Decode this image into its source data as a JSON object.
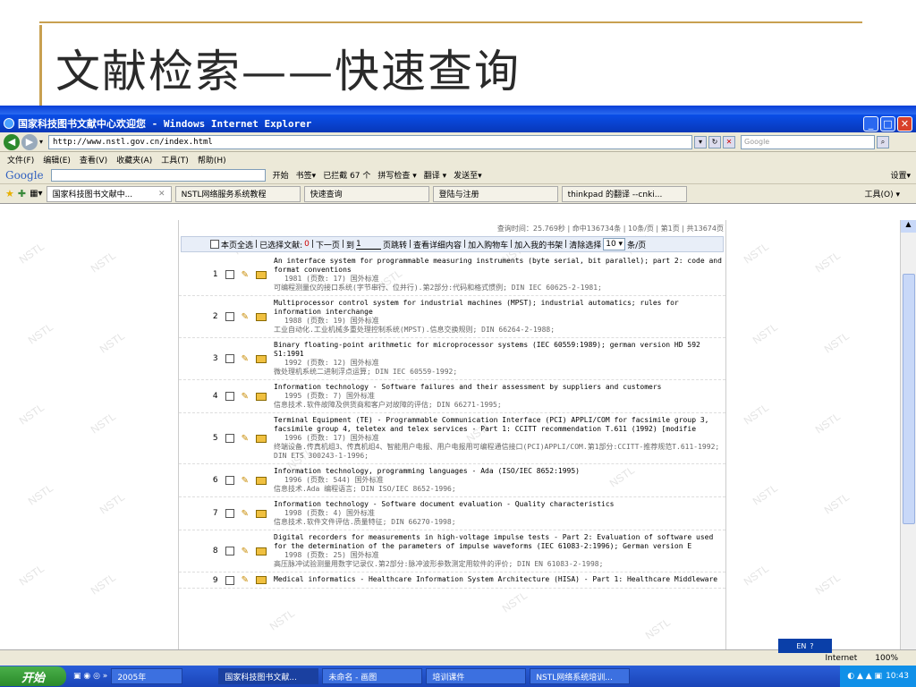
{
  "slide": {
    "title": "文献检索——快速查询"
  },
  "browser": {
    "title": "国家科技图书文献中心欢迎您 - Windows Internet Explorer",
    "url": "http://www.nstl.gov.cn/index.html",
    "search_placeholder": "Google",
    "menu": [
      "文件(F)",
      "编辑(E)",
      "查看(V)",
      "收藏夹(A)",
      "工具(T)",
      "帮助(H)"
    ],
    "google_toolbar": {
      "logo": "Google",
      "items": [
        "开始",
        "书签▾",
        "已拦截 67 个",
        "拼写检查 ▾",
        "翻译 ▾",
        "发送至▾"
      ],
      "settings": "设置▾"
    },
    "tabs": [
      "国家科技图书文献中...",
      "NSTL网络服务系统教程",
      "快速查询",
      "登陆与注册",
      "thinkpad 的翻译 --cnki..."
    ],
    "tools_label": "工具(O) ▾",
    "status": {
      "zone": "Internet",
      "zoom": "100%"
    }
  },
  "results": {
    "stats": "查询时间：25.769秒 | 命中136734条 | 10条/页 | 第1页 | 共13674页",
    "toolbar": {
      "select_all": "本页全选",
      "selected": "已选择文献:",
      "selected_count": "0",
      "next_page": "下一页",
      "goto_label": "到",
      "goto_value": "1",
      "goto_suffix": "页跳转",
      "view_detail": "查看详细内容",
      "add_cart": "加入购物车",
      "add_shelf": "加入我的书架",
      "clear": "清除选择",
      "per_page": "10",
      "per_page_suffix": "条/页"
    },
    "items": [
      {
        "num": "1",
        "title": "An interface system for programmable measuring instruments (byte serial, bit parallel); part 2: code and format conventions",
        "meta": "1981  (页数: 17)  国外标准",
        "cn": "可编程测量仪的接口系统(字节串行、位并行).第2部分:代码和格式惯例; DIN IEC 60625-2-1981;"
      },
      {
        "num": "2",
        "title": "Multiprocessor control system for industrial machines (MPST); industrial automatics; rules for information interchange",
        "meta": "1988  (页数: 19)  国外标准",
        "cn": "工业自动化.工业机械多重处理控制系统(MPST).信息交换规则; DIN 66264-2-1988;"
      },
      {
        "num": "3",
        "title": "Binary floating-point arithmetic for microprocessor systems (IEC 60559:1989); german version HD 592 S1:1991",
        "meta": "1992  (页数: 12)  国外标准",
        "cn": "微处理机系统二进制浮点运算; DIN IEC 60559-1992;"
      },
      {
        "num": "4",
        "title": "Information technology - Software failures and their assessment by suppliers and customers",
        "meta": "1995  (页数: 7)  国外标准",
        "cn": "信息技术.软件故障及供货商和客户对故障的评估; DIN 66271-1995;"
      },
      {
        "num": "5",
        "title": "Terminal Equipment (TE) - Programmable Communication Interface (PCI) APPLI/COM for facsimile group 3, facsimile group 4, teletex and telex services - Part 1: CCITT recommendation T.611 (1992) [modifie",
        "meta": "1996  (页数: 17)  国外标准",
        "cn": "终端设备.传真机组3、传真机组4、智能用户电报、用户电报用可编程通信接口(PCI)APPLI/COM.第1部分:CCITT-推荐规范T.611-1992; DIN ETS 300243-1-1996;"
      },
      {
        "num": "6",
        "title": "Information technology, programming languages - Ada (ISO/IEC 8652:1995)",
        "meta": "1996  (页数: 544)  国外标准",
        "cn": "信息技术.Ada 编程语言; DIN ISO/IEC 8652-1996;"
      },
      {
        "num": "7",
        "title": "Information technology - Software document evaluation - Quality characteristics",
        "meta": "1998  (页数: 4)  国外标准",
        "cn": "信息技术.软件文件评估.质量特征; DIN 66270-1998;"
      },
      {
        "num": "8",
        "title": "Digital recorders for measurements in high-voltage impulse tests - Part 2: Evaluation of software used for the determination of the parameters of impulse waveforms (IEC 61083-2:1996); German version E",
        "meta": "1998  (页数: 25)  国外标准",
        "cn": "高压脉冲试验测量用数字记录仪.第2部分:脉冲波形参数测定用软件的评价; DIN EN 61083-2-1998;"
      },
      {
        "num": "9",
        "title": "Medical informatics - Healthcare Information System Architecture (HISA) - Part 1: Healthcare Middleware",
        "meta": "",
        "cn": ""
      }
    ]
  },
  "watermark": "NSTL",
  "taskbar": {
    "start": "开始",
    "items": [
      "2005年",
      "国家科技图书文献...",
      "未命名 - 画图",
      "培训课件",
      "NSTL网络系统培训..."
    ],
    "ime": "EN",
    "clock": "10:43"
  }
}
